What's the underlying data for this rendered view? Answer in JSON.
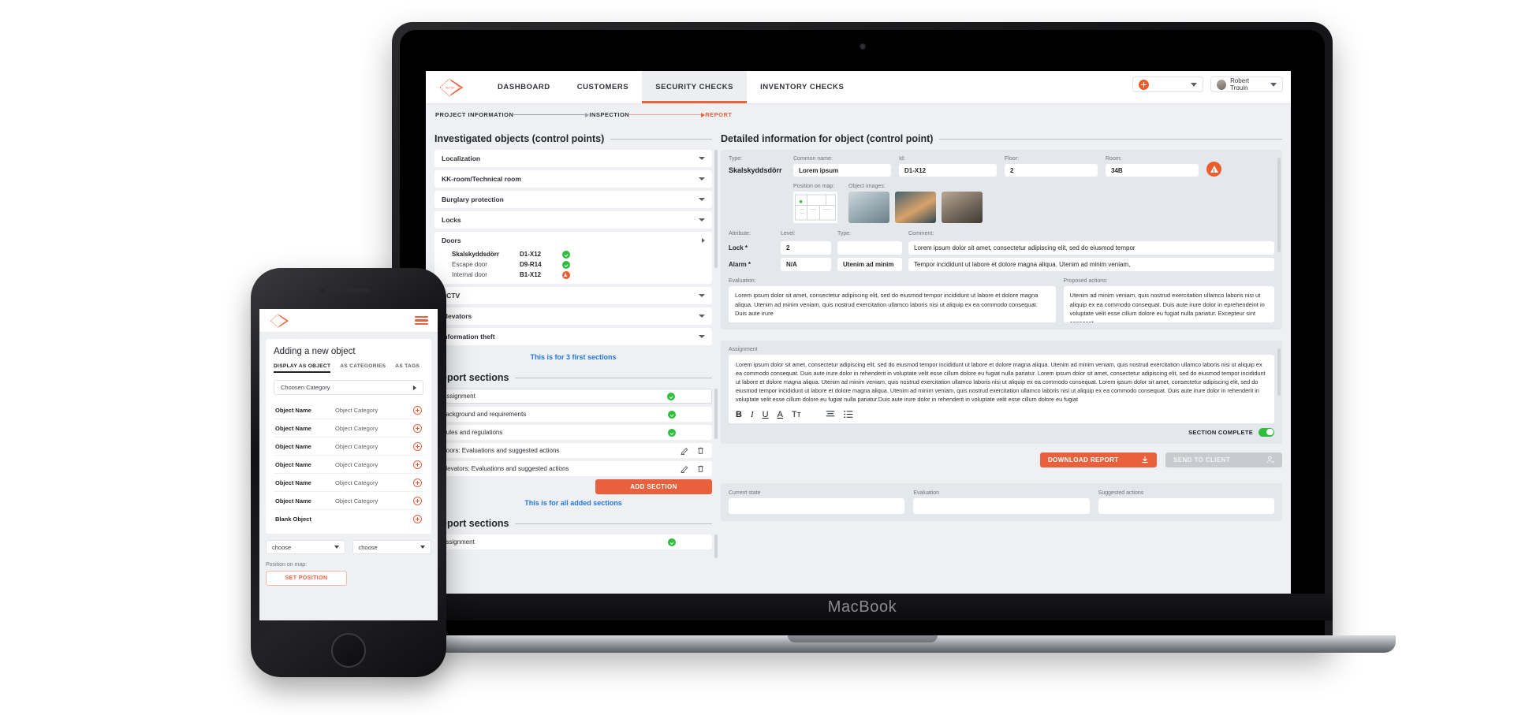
{
  "device": {
    "laptop_brand": "MacBook"
  },
  "nav": {
    "logo": "logo-icon",
    "links": [
      {
        "label": "DASHBOARD",
        "active": false
      },
      {
        "label": "CUSTOMERS",
        "active": false
      },
      {
        "label": "SECURITY CHECKS",
        "active": true
      },
      {
        "label": "INVENTORY CHECKS",
        "active": false
      }
    ],
    "add_pill": "add-dropdown",
    "user": {
      "name": "Robert Trouin"
    }
  },
  "breadcrumb": {
    "steps": [
      {
        "label": "PROJECT INFORMATION",
        "current": false
      },
      {
        "label": "INSPECTION",
        "current": false
      },
      {
        "label": "REPORT",
        "current": true
      }
    ]
  },
  "left_panel": {
    "title": "Investigated objects (control points)",
    "accordions": [
      {
        "label": "Localization",
        "expanded": false
      },
      {
        "label": "KK-room/Technical room",
        "expanded": false
      },
      {
        "label": "Burglary protection",
        "expanded": false
      },
      {
        "label": "Locks",
        "expanded": false
      }
    ],
    "doors_group": {
      "label": "Doors",
      "expanded": true,
      "objects": [
        {
          "name": "Skalskyddsdörr",
          "id": "D1-X12",
          "status": "ok",
          "selected": true
        },
        {
          "name": "Escape door",
          "id": "D9-R14",
          "status": "ok",
          "selected": false
        },
        {
          "name": "Internal door",
          "id": "B1-X12",
          "status": "warning",
          "selected": false
        }
      ]
    },
    "accordions_after": [
      {
        "label": "CCTV",
        "expanded": false
      },
      {
        "label": "Elevators",
        "expanded": false
      },
      {
        "label": "Information theft",
        "expanded": false
      }
    ]
  },
  "right_panel": {
    "title": "Detailed information for object (control point)",
    "fields": {
      "type_label": "Type:",
      "type_value": "Skalskyddsdörr",
      "common_name_label": "Common name:",
      "common_name_value": "Lorem ipsum",
      "id_label": "Id:",
      "id_value": "D1-X12",
      "floor_label": "Floor:",
      "floor_value": "2",
      "room_label": "Room:",
      "room_value": "34B",
      "alert_icon": "warning-icon"
    },
    "media": {
      "position_label": "Position on map:",
      "images_label": "Object images:",
      "thumbnails": [
        "office-photo-1",
        "office-photo-2",
        "office-photo-3"
      ]
    },
    "attributes": {
      "headers": [
        "Attribute:",
        "Level:",
        "Type:",
        "Comment:"
      ],
      "rows": [
        {
          "attribute": "Lock *",
          "level": "2",
          "type": "",
          "comment": "Lorem ipsum dolor sit amet, consectetur adipiscing elit, sed do eiusmod tempor"
        },
        {
          "attribute": "Alarm *",
          "level": "N/A",
          "type": "Utenim ad minim",
          "comment": "Tempor incididunt ut labore et dolore magna aliqua. Utenim ad minim veniam,"
        }
      ]
    },
    "evaluation": {
      "label": "Evaluation:",
      "text": "Lorem ipsum dolor sit amet, consectetur adipiscing elit, sed do eiusmod tempor incididunt ut labore et dolore magna aliqua. Utenim ad minim veniam, quis nostrud exercitation ullamco laboris nisi ut aliquip ex ea commodo consequat. Duis aute irure"
    },
    "proposed_actions": {
      "label": "Proposed actions:",
      "text": "Utenim ad minim veniam, quis nostrud exercitation ullamco laboris nisi ut aliquip ex ea commodo consequat. Duis aute irure dolor in eprehendeint in voluptate velit esse cillum dolore eu fugiat nulla pariatur. Excepteur sint occaecat"
    }
  },
  "hints": {
    "first_sections": "This is for 3 first sections",
    "all_sections": "This is for all added sections"
  },
  "report_sections": {
    "title": "Report sections",
    "rows": [
      {
        "label": "Assignment",
        "status": "ok",
        "selected": true,
        "editable": false
      },
      {
        "label": "Background and requirements",
        "status": "ok",
        "selected": false,
        "editable": false
      },
      {
        "label": "Rules and regulations",
        "status": "ok",
        "selected": false,
        "editable": false
      },
      {
        "label": "Doors: Evaluations and suggested actions",
        "status": "none",
        "selected": false,
        "editable": true
      },
      {
        "label": "Elevators: Evaluations and suggested actions",
        "status": "none",
        "selected": false,
        "editable": true
      }
    ],
    "add_button": "ADD SECTION"
  },
  "assignment": {
    "label": "Assignment",
    "text": "Lorem ipsum dolor sit amet, consectetur adipiscing elit, sed do eiusmod tempor incididunt ut labore et dolore magna aliqua. Utenim ad minim veniam, quis nostrud exercitation ullamco laboris nisi ut aliquip ex ea commodo consequat. Duis aute irure dolor in rehenderit in voluptate velit esse cillum dolore eu fugiat nulla pariatur. Lorem ipsum dolor sit amet, consectetur adipiscing elit, sed do eiusmod tempor incididunt ut labore et dolore magna aliqua. Utenim ad minim veniam, quis nostrud exercitation ullamco laboris nisi ut aliquip ex ea commodo consequat. Lorem ipsum dolor sit amet, consectetur adipiscing elit, sed do eiusmod tempor incididunt ut labore et dolore magna aliqua. Utenim ad minim veniam, quis nostrud exercitation ullamco laboris nisi ut aliquip ex ea commodo consequat. Duis aute irure dolor in rehenderit in voluptate velit esse cillum dolore eu fugiat nulla pariatur.Duis aute irure dolor in rehenderit in voluptate velit esse cillum dolore eu fugiat",
    "toolbar": [
      "B",
      "I",
      "U",
      "A",
      "Tт",
      "align-icon",
      "list-icon"
    ],
    "section_complete_label": "SECTION COMPLETE",
    "section_complete_on": true
  },
  "actions": {
    "download_label": "DOWNLOAD REPORT",
    "download_icon": "download-icon",
    "send_label": "SEND TO CLIENT",
    "send_icon": "person-send-icon",
    "download_short": "DOWNLOAD"
  },
  "bottom": {
    "report_sections_title": "Report sections",
    "first_row": {
      "label": "Assignment",
      "status": "ok"
    },
    "columns": [
      "Current state",
      "Evaluation",
      "Suggested actions"
    ]
  },
  "phone": {
    "logo": "logo-icon",
    "menu": "hamburger-icon",
    "title": "Adding a new object",
    "tabs": [
      {
        "label": "DISPLAY AS OBJECT",
        "active": true
      },
      {
        "label": "AS CATEGORIES",
        "active": false
      },
      {
        "label": "AS TAGS",
        "active": false
      }
    ],
    "category_select": "Choosen Category",
    "objects": [
      {
        "name": "Object Name",
        "category": "Object Category"
      },
      {
        "name": "Object Name",
        "category": "Object Category"
      },
      {
        "name": "Object Name",
        "category": "Object Category"
      },
      {
        "name": "Object Name",
        "category": "Object Category"
      },
      {
        "name": "Object Name",
        "category": "Object Category"
      },
      {
        "name": "Object Name",
        "category": "Object Category"
      }
    ],
    "blank_object": "Blank Object",
    "selects": [
      "choose",
      "choose"
    ],
    "position_label": "Position on map:",
    "set_position": "SET POSITION"
  },
  "colors": {
    "accent": "#e8613c",
    "accent_alt": "#ef5c2b",
    "ok": "#2fbd3c",
    "hint_blue": "#2277e0",
    "page_bg": "#eef0f4",
    "panel_bg": "#e4e7ec"
  }
}
